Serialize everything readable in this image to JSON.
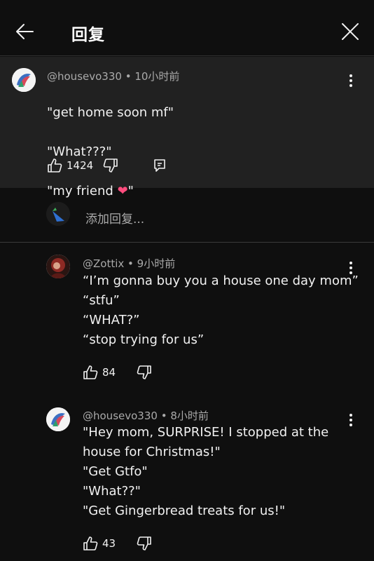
{
  "header": {
    "title": "回复"
  },
  "top_comment": {
    "author": "@housevo330",
    "time": "10小时前",
    "lines": [
      "\"get home soon mf\"",
      "\"What???\"",
      "\"my friend"
    ],
    "heart_emoji": "❤",
    "line3_end": "\"",
    "likes": "1424"
  },
  "add_reply": {
    "placeholder": "添加回复..."
  },
  "replies": [
    {
      "author": "@Zottix",
      "time": "9小时前",
      "text": "“I’m gonna buy you a house one day mom”\n“stfu”\n“WHAT?”\n“stop trying for us”",
      "likes": "84"
    },
    {
      "author": "@housevo330",
      "time": "8小时前",
      "text": "\"Hey mom, SURPRISE! I stopped at the\nhouse for Christmas!\"\n\"Get Gtfo\"\n\"What??\"\n\"Get Gingerbread treats for us!\"",
      "likes": "43"
    }
  ],
  "colors": {
    "background": "#0f0f0f",
    "highlight_panel": "#212121",
    "secondary_text": "#aaaaaa",
    "heart": "#ff4d7e"
  }
}
